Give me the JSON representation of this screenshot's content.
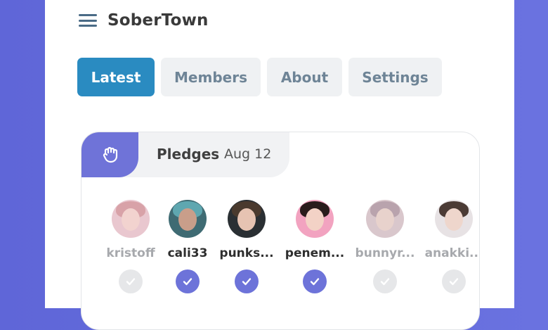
{
  "app": {
    "title": "SoberTown"
  },
  "tabs": [
    {
      "label": "Latest",
      "active": true
    },
    {
      "label": "Members",
      "active": false
    },
    {
      "label": "About",
      "active": false
    },
    {
      "label": "Settings",
      "active": false
    }
  ],
  "pledges_card": {
    "title": "Pledges",
    "date": "Aug 12",
    "icon": "raised-fist-icon",
    "members": [
      {
        "name": "kristoff",
        "checked": false,
        "active": false
      },
      {
        "name": "cali33",
        "checked": true,
        "active": true
      },
      {
        "name": "punks...",
        "checked": true,
        "active": true
      },
      {
        "name": "penem...",
        "checked": true,
        "active": true
      },
      {
        "name": "bunnyr...",
        "checked": false,
        "active": false
      },
      {
        "name": "anakki...",
        "checked": false,
        "active": false
      }
    ]
  },
  "colors": {
    "background": "#6068d9",
    "accent_blue": "#2a8bc1",
    "accent_purple": "#6d73d9",
    "check_off": "#e6e7e9"
  }
}
